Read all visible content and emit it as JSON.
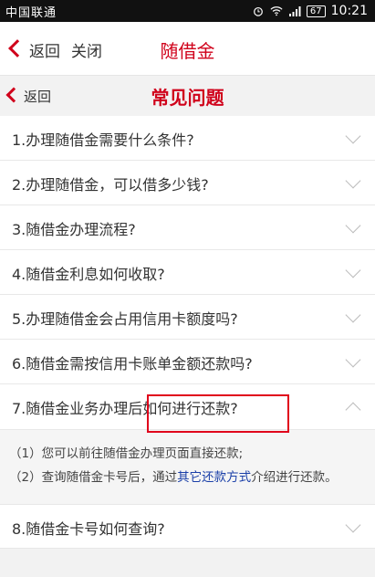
{
  "status_bar": {
    "carrier": "中国联通",
    "battery": "67",
    "time": "10:21"
  },
  "app_header": {
    "back_label": "返回",
    "close_label": "关闭",
    "title": "随借金"
  },
  "sub_header": {
    "back_label": "返回",
    "title": "常见问题"
  },
  "faq": [
    {
      "question": "1.办理随借金需要什么条件?",
      "expanded": false
    },
    {
      "question": "2.办理随借金，可以借多少钱?",
      "expanded": false
    },
    {
      "question": "3.随借金办理流程?",
      "expanded": false
    },
    {
      "question": "4.随借金利息如何收取?",
      "expanded": false
    },
    {
      "question": "5.办理随借金会占用信用卡额度吗?",
      "expanded": false
    },
    {
      "question": "6.随借金需按信用卡账单金额还款吗?",
      "expanded": false
    },
    {
      "question": "7.随借金业务办理后如何进行还款?",
      "expanded": true
    },
    {
      "question": "8.随借金卡号如何查询?",
      "expanded": false
    }
  ],
  "answer7": {
    "line1": "（1）您可以前往随借金办理页面直接还款;",
    "line2_prefix": "（2）查询随借金卡号后，通过",
    "line2_link": "其它还款方式",
    "line2_suffix": "介绍进行还款。"
  },
  "colors": {
    "brand_red": "#d0021b",
    "link_blue": "#1a3fa8"
  }
}
